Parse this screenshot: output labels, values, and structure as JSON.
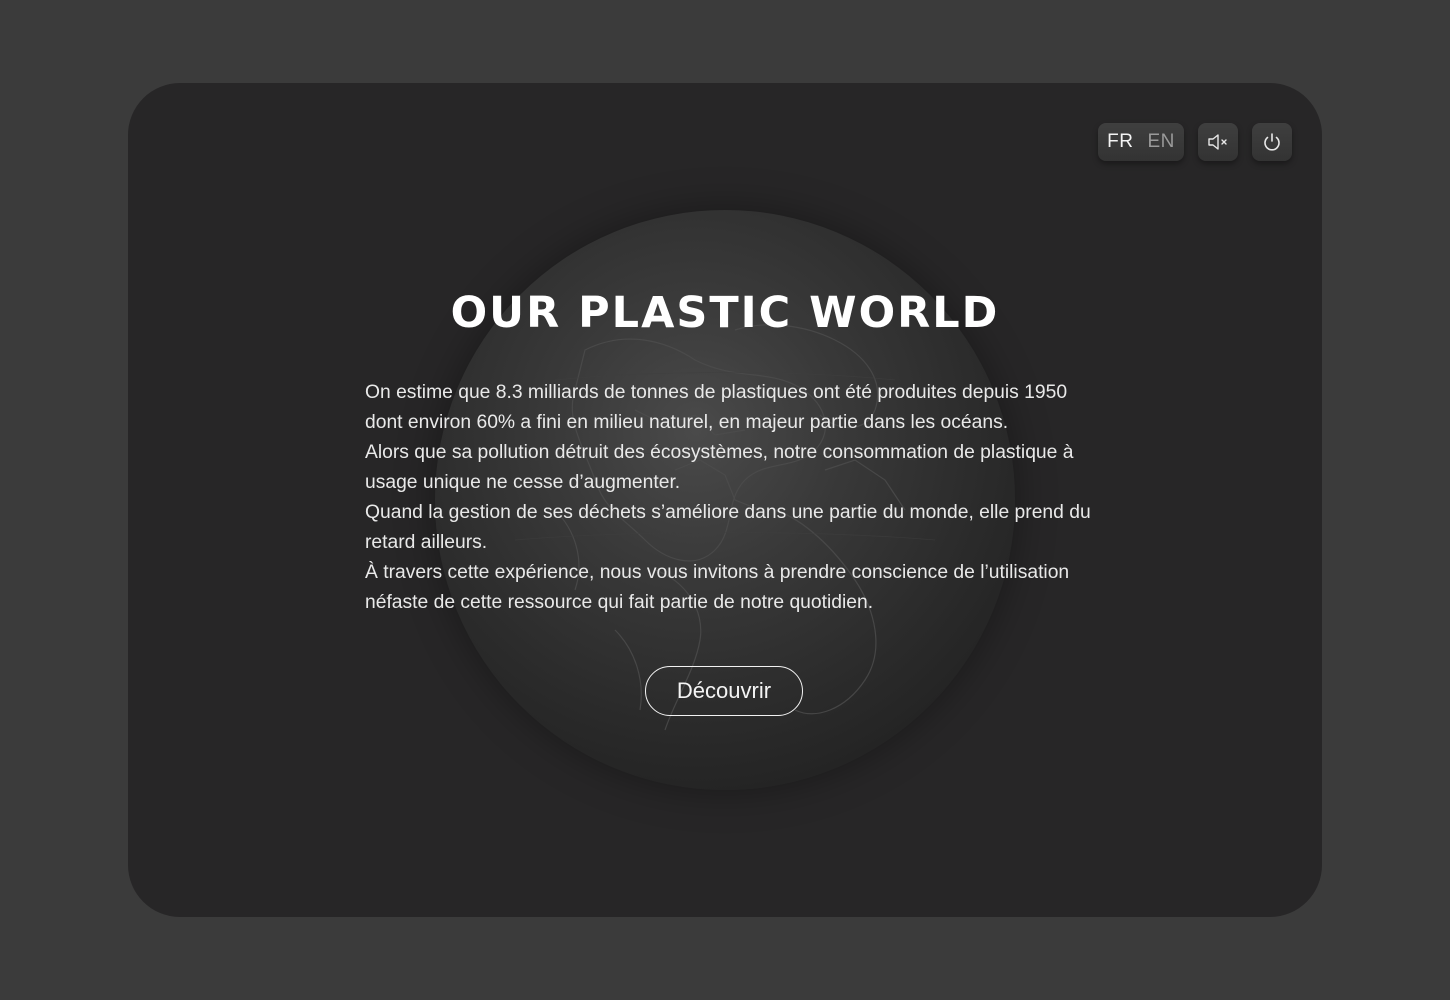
{
  "header": {
    "languages": [
      "FR",
      "EN"
    ],
    "active_language": "FR",
    "mute_icon": "speaker-muted-icon",
    "power_icon": "power-icon"
  },
  "intro": {
    "title": "OUR PLASTIC WORLD",
    "paragraphs": [
      "On estime que 8.3 milliards de tonnes de plastiques ont été produites depuis 1950 dont environ 60% a fini en milieu naturel, en majeur partie dans les océans.",
      "Alors que sa pollution détruit des écosystèmes, notre consommation de plastique à usage unique ne cesse d’augmenter.",
      "Quand la gestion de ses déchets s’améliore dans une partie du monde, elle prend du retard ailleurs.",
      "À travers cette expérience, nous vous invitons à prendre conscience de l’utilisation néfaste de cette ressource qui fait partie de notre quotidien."
    ],
    "cta_label": "Découvrir"
  },
  "colors": {
    "page_background": "#3b3b3b",
    "card_background": "#272627",
    "text": "#e9e9e9",
    "title": "#ffffff"
  }
}
